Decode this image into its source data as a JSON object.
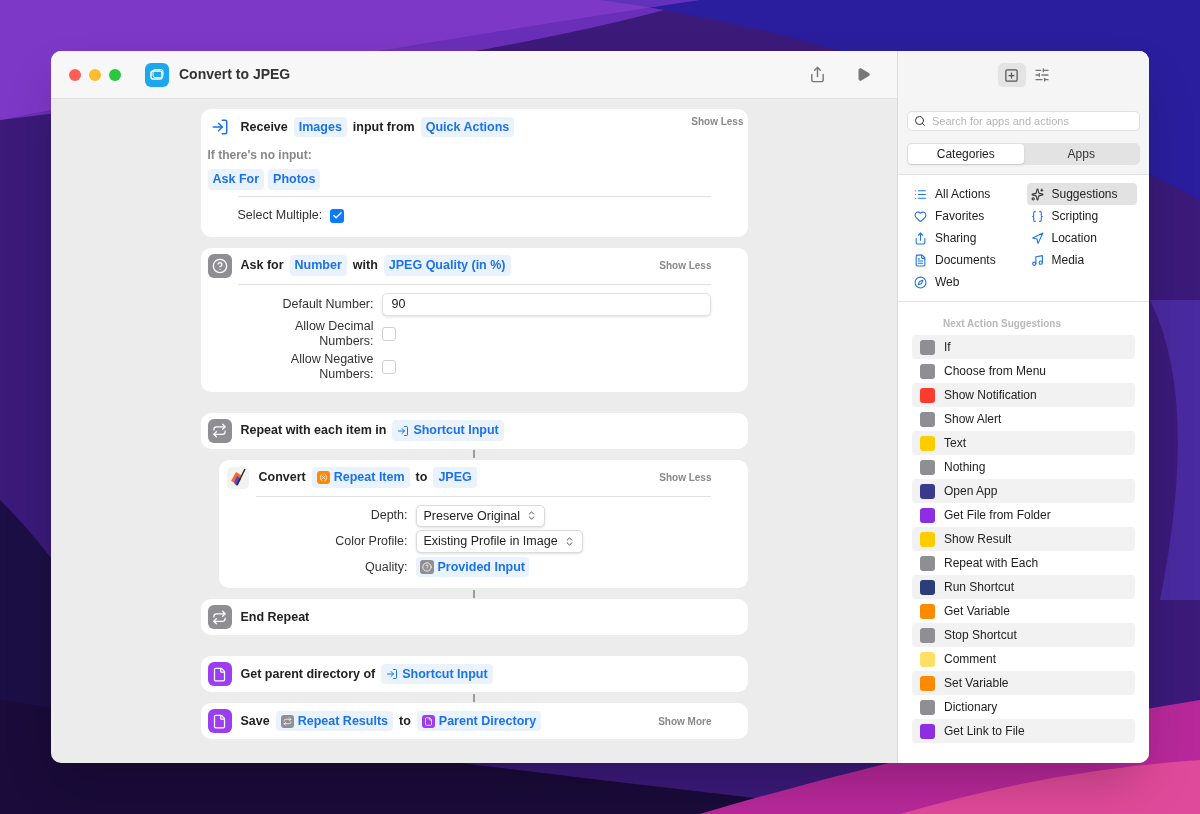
{
  "window": {
    "title": "Convert to JPEG"
  },
  "actions": [
    {
      "kind": "receive",
      "toggle": "Show Less",
      "tokens": [
        {
          "kind": "text",
          "text": "Receive"
        },
        {
          "kind": "token",
          "text": "Images"
        },
        {
          "kind": "text",
          "text": "input from"
        },
        {
          "kind": "token",
          "text": "Quick Actions"
        }
      ],
      "no_input_label": "If there's no input:",
      "no_input_tokens": [
        {
          "kind": "token",
          "text": "Ask For"
        },
        {
          "kind": "token",
          "text": "Photos"
        }
      ],
      "fields": [
        {
          "kind": "checkbox",
          "label": "Select Multiple:",
          "checked": true
        }
      ]
    },
    {
      "kind": "ask",
      "toggle": "Show Less",
      "tokens": [
        {
          "kind": "text",
          "text": "Ask for"
        },
        {
          "kind": "token",
          "text": "Number"
        },
        {
          "kind": "text",
          "text": "with"
        },
        {
          "kind": "token",
          "text": "JPEG Quality (in %)"
        }
      ],
      "fields": [
        {
          "kind": "number",
          "label": "Default Number:",
          "value": "90"
        },
        {
          "kind": "checkbox",
          "label": "Allow Decimal Numbers:",
          "checked": false
        },
        {
          "kind": "checkbox",
          "label": "Allow Negative Numbers:",
          "checked": false
        }
      ]
    },
    {
      "kind": "repeat",
      "tokens": [
        {
          "kind": "text",
          "text": "Repeat with each item in"
        },
        {
          "kind": "input_token",
          "text": "Shortcut Input"
        }
      ],
      "children": [
        {
          "kind": "convert",
          "toggle": "Show Less",
          "tokens": [
            {
              "kind": "text",
              "text": "Convert"
            },
            {
              "kind": "variable_token",
              "text": "Repeat Item"
            },
            {
              "kind": "text",
              "text": "to"
            },
            {
              "kind": "token",
              "text": "JPEG"
            }
          ],
          "fields": [
            {
              "kind": "popup",
              "label": "Depth:",
              "value": "Preserve Original"
            },
            {
              "kind": "popup",
              "label": "Color Profile:",
              "value": "Existing Profile in Image"
            },
            {
              "kind": "ask_token",
              "label": "Quality:",
              "value": "Provided Input"
            }
          ]
        }
      ]
    },
    {
      "kind": "end_repeat",
      "tokens": [
        {
          "kind": "text",
          "text": "End Repeat"
        }
      ]
    },
    {
      "kind": "get_parent",
      "tokens": [
        {
          "kind": "text",
          "text": "Get parent directory of"
        },
        {
          "kind": "input_token",
          "text": "Shortcut Input"
        }
      ]
    },
    {
      "kind": "save",
      "toggle": "Show More",
      "tokens": [
        {
          "kind": "text",
          "text": "Save"
        },
        {
          "kind": "repeat_token",
          "text": "Repeat Results"
        },
        {
          "kind": "text",
          "text": "to"
        },
        {
          "kind": "file_token",
          "text": "Parent Directory"
        }
      ]
    }
  ],
  "sidebar": {
    "search": {
      "placeholder": "Search for apps and actions"
    },
    "segments": [
      {
        "label": "Categories",
        "selected": true
      },
      {
        "label": "Apps",
        "selected": false
      }
    ],
    "categories": [
      {
        "label": "All Actions",
        "selected": false
      },
      {
        "label": "Suggestions",
        "selected": true
      },
      {
        "label": "Favorites",
        "selected": false
      },
      {
        "label": "Scripting",
        "selected": false
      },
      {
        "label": "Sharing",
        "selected": false
      },
      {
        "label": "Location",
        "selected": false
      },
      {
        "label": "Documents",
        "selected": false
      },
      {
        "label": "Media",
        "selected": false
      },
      {
        "label": "Web",
        "selected": false
      }
    ],
    "suggestions_heading": "Next Action Suggestions",
    "suggestions": [
      {
        "label": "If",
        "color": "#8e8e93"
      },
      {
        "label": "Choose from Menu",
        "color": "#8e8e93"
      },
      {
        "label": "Show Notification",
        "color": "#ff3b30"
      },
      {
        "label": "Show Alert",
        "color": "#8e8e93"
      },
      {
        "label": "Text",
        "color": "#ffcc00"
      },
      {
        "label": "Nothing",
        "color": "#8e8e93"
      },
      {
        "label": "Open App",
        "color": "#3a3a8c"
      },
      {
        "label": "Get File from Folder",
        "color": "#8e2de2"
      },
      {
        "label": "Show Result",
        "color": "#ffcc00"
      },
      {
        "label": "Repeat with Each",
        "color": "#8e8e93"
      },
      {
        "label": "Run Shortcut",
        "color": "#2c3e7a"
      },
      {
        "label": "Get Variable",
        "color": "#ff8a00"
      },
      {
        "label": "Stop Shortcut",
        "color": "#8e8e93"
      },
      {
        "label": "Comment",
        "color": "#ffe066"
      },
      {
        "label": "Set Variable",
        "color": "#ff8a00"
      },
      {
        "label": "Dictionary",
        "color": "#8e8e93"
      },
      {
        "label": "Get Link to File",
        "color": "#8e2de2"
      }
    ]
  }
}
